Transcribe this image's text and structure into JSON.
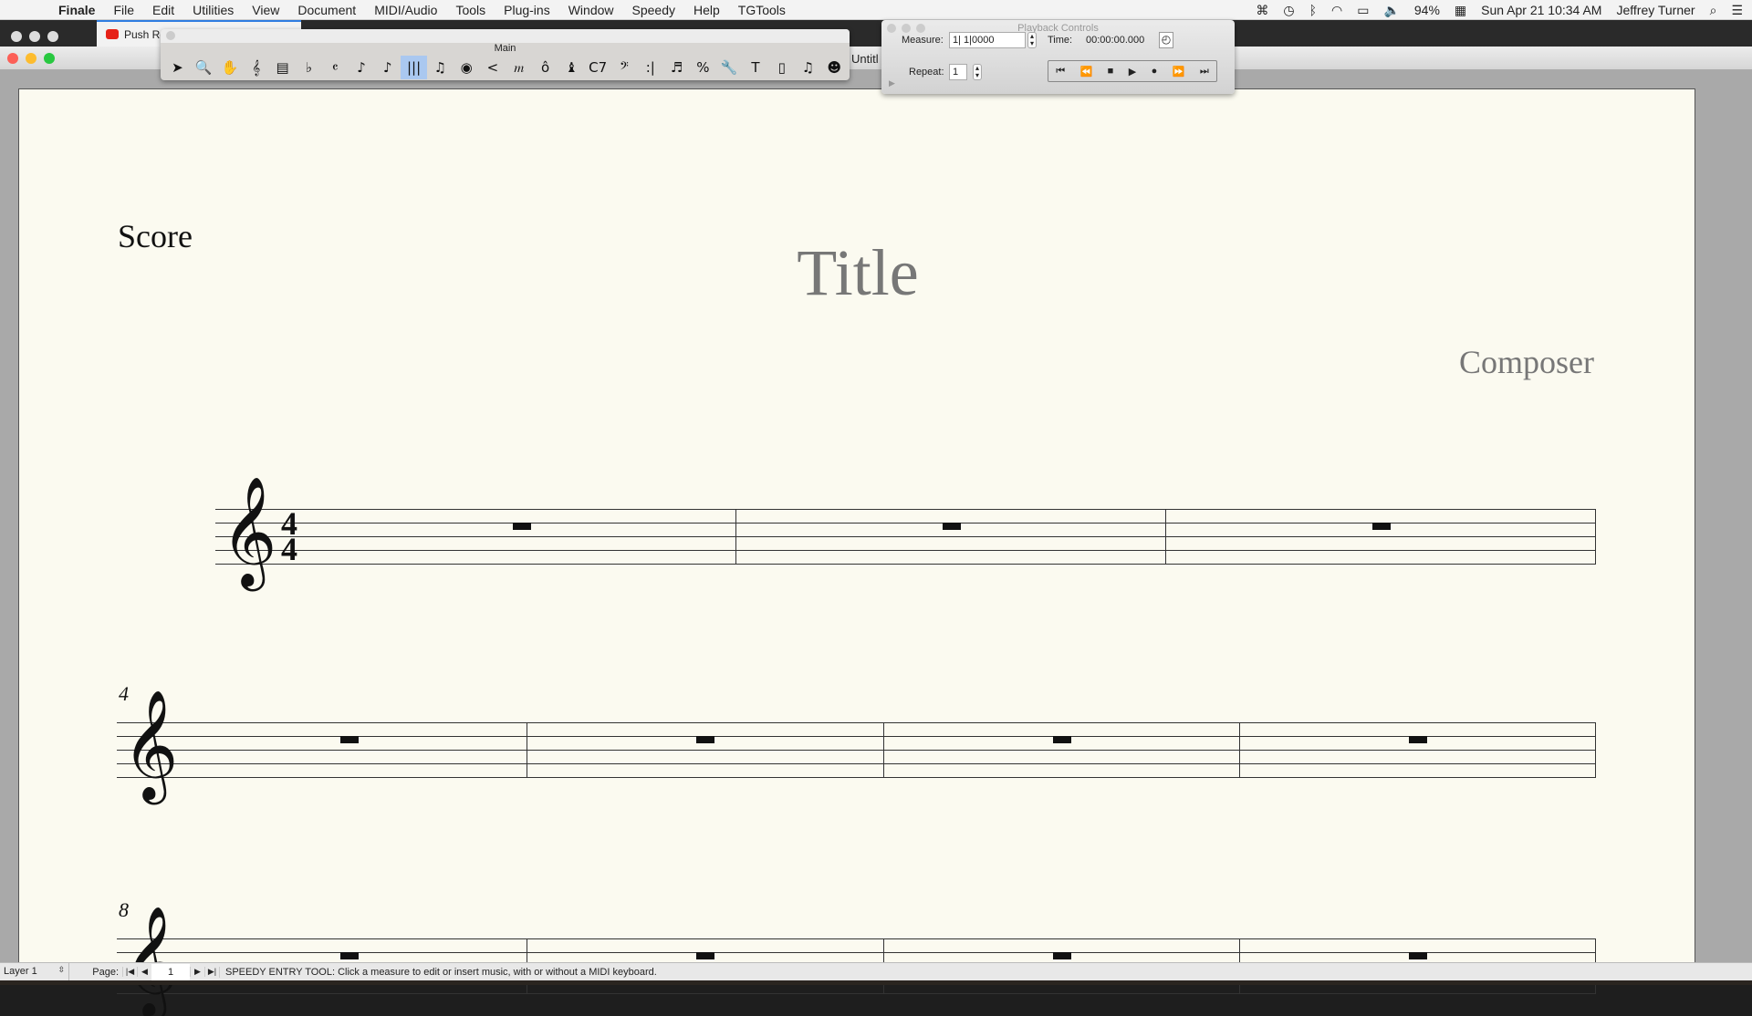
{
  "menubar": {
    "apple": "",
    "app": "Finale",
    "items": [
      "File",
      "Edit",
      "Utilities",
      "View",
      "Document",
      "MIDI/Audio",
      "Tools",
      "Plug-ins",
      "Window",
      "Speedy",
      "Help",
      "TGTools"
    ],
    "battery": "94%",
    "datetime": "Sun Apr 21  10:34 AM",
    "user": "Jeffrey Turner"
  },
  "browser": {
    "tab_label": "Push Re"
  },
  "window": {
    "title": "Untitl"
  },
  "tool_palette": {
    "title": "Main",
    "selected_index": 9,
    "tools": [
      {
        "icon": "selection-tool-icon",
        "glyph": "➤"
      },
      {
        "icon": "zoom-tool-icon",
        "glyph": "🔍"
      },
      {
        "icon": "hand-grabber-icon",
        "glyph": "✋"
      },
      {
        "icon": "staff-tool-icon",
        "glyph": "𝄞"
      },
      {
        "icon": "measure-tool-icon",
        "glyph": "▤"
      },
      {
        "icon": "key-signature-icon",
        "glyph": "♭"
      },
      {
        "icon": "time-signature-icon",
        "glyph": "𝄴"
      },
      {
        "icon": "simple-entry-icon",
        "glyph": "♪"
      },
      {
        "icon": "speedy-entry-icon",
        "glyph": "♪"
      },
      {
        "icon": "hyperscribe-icon",
        "glyph": "|||"
      },
      {
        "icon": "tuplet-icon",
        "glyph": "♫"
      },
      {
        "icon": "smart-shape-icon",
        "glyph": "◉"
      },
      {
        "icon": "hairpin-icon",
        "glyph": "<"
      },
      {
        "icon": "expression-icon",
        "glyph": "𝆐"
      },
      {
        "icon": "articulation-icon",
        "glyph": "ô"
      },
      {
        "icon": "mirror-tool-icon",
        "glyph": "♝"
      },
      {
        "icon": "chord-tool-icon",
        "glyph": "C7"
      },
      {
        "icon": "lyrics-tool-icon",
        "glyph": "𝄢"
      },
      {
        "icon": "repeat-tool-icon",
        "glyph": ":|"
      },
      {
        "icon": "mass-edit-icon",
        "glyph": "♬"
      },
      {
        "icon": "resize-tool-icon",
        "glyph": "%"
      },
      {
        "icon": "special-tools-icon",
        "glyph": "🔧"
      },
      {
        "icon": "text-tool-icon",
        "glyph": "T"
      },
      {
        "icon": "page-layout-icon",
        "glyph": "▯"
      },
      {
        "icon": "graphics-tool-icon",
        "glyph": "♫"
      },
      {
        "icon": "human-playback-icon",
        "glyph": "☻"
      }
    ]
  },
  "playback": {
    "title": "Playback Controls",
    "measure_label": "Measure:",
    "measure_value": "1| 1|0000",
    "time_label": "Time:",
    "time_value": "00:00:00.000",
    "repeat_label": "Repeat:",
    "repeat_value": "1",
    "transport": [
      {
        "icon": "go-to-start-icon",
        "glyph": "⏮"
      },
      {
        "icon": "rewind-icon",
        "glyph": "⏪"
      },
      {
        "icon": "stop-icon",
        "glyph": "■"
      },
      {
        "icon": "play-icon",
        "glyph": "▶"
      },
      {
        "icon": "record-icon",
        "glyph": "●"
      },
      {
        "icon": "fast-forward-icon",
        "glyph": "⏩"
      },
      {
        "icon": "go-to-end-icon",
        "glyph": "⏭"
      }
    ]
  },
  "score": {
    "label": "Score",
    "title": "Title",
    "composer": "Composer",
    "time_signature": {
      "top": "4",
      "bottom": "4"
    },
    "systems": [
      {
        "measure_number": "",
        "measures": 3
      },
      {
        "measure_number": "4",
        "measures": 4
      },
      {
        "measure_number": "8",
        "measures": 4
      }
    ]
  },
  "statusbar": {
    "layer": "Layer 1",
    "page_label": "Page:",
    "page_value": "1",
    "message": "SPEEDY ENTRY TOOL: Click a measure to edit or insert music, with or without a MIDI keyboard."
  }
}
